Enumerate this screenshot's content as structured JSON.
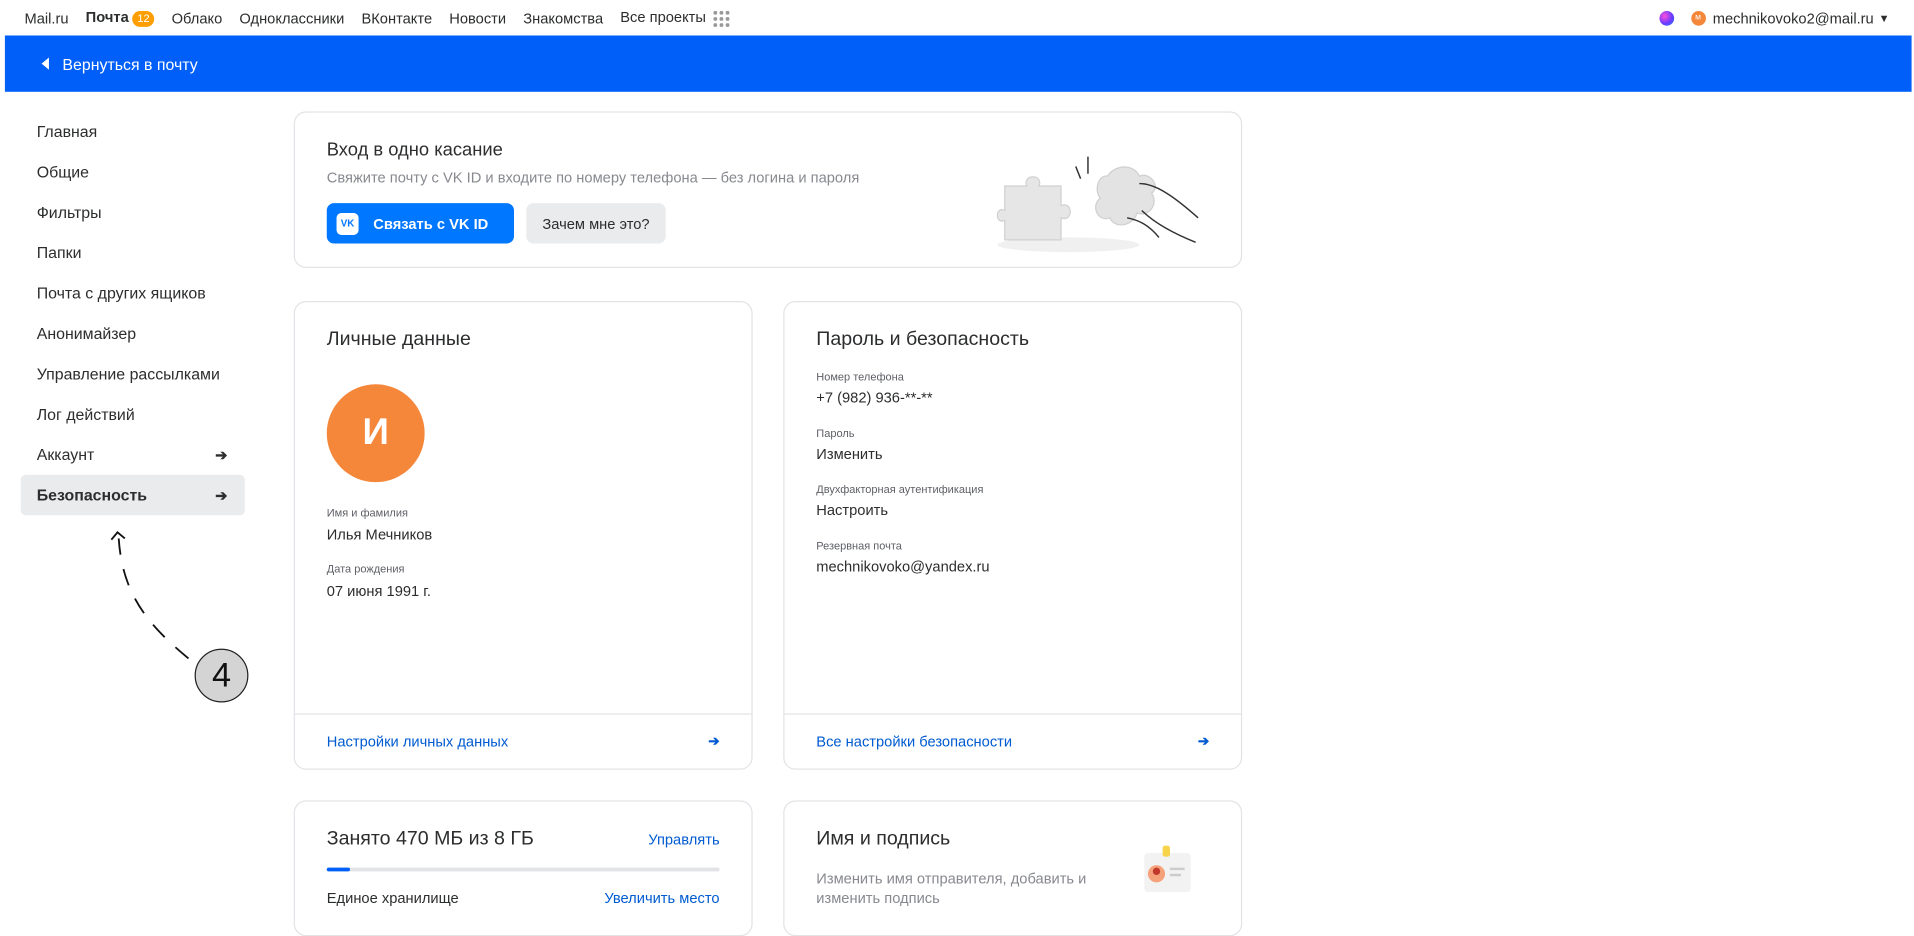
{
  "topnav": {
    "items": [
      "Mail.ru",
      "Почта",
      "Облако",
      "Одноклассники",
      "ВКонтакте",
      "Новости",
      "Знакомства",
      "Все проекты"
    ],
    "mail_badge": "12",
    "user_initial": "м",
    "user_email": "mechnikovoko2@mail.ru"
  },
  "bluebar": {
    "back_label": "Вернуться в почту"
  },
  "sidebar": {
    "items": [
      {
        "label": "Главная"
      },
      {
        "label": "Общие"
      },
      {
        "label": "Фильтры"
      },
      {
        "label": "Папки"
      },
      {
        "label": "Почта с других ящиков"
      },
      {
        "label": "Анонимайзер"
      },
      {
        "label": "Управление рассылками"
      },
      {
        "label": "Лог действий"
      },
      {
        "label": "Аккаунт"
      },
      {
        "label": "Безопасность"
      }
    ]
  },
  "onetouch": {
    "title": "Вход в одно касание",
    "subtitle": "Свяжите почту с VK ID и входите по номеру телефона — без логина и пароля",
    "vk_button": "Связать с VK ID",
    "vk_logo": "VK",
    "why_button": "Зачем мне это?"
  },
  "personal": {
    "title": "Личные данные",
    "avatar_letter": "И",
    "name_label": "Имя и фамилия",
    "name_value": "Илья Мечников",
    "birth_label": "Дата рождения",
    "birth_value": "07 июня 1991 г.",
    "footer_link": "Настройки личных данных"
  },
  "security": {
    "title": "Пароль и безопасность",
    "phone_label": "Номер телефона",
    "phone_value": "+7 (982) 936-**-**",
    "password_label": "Пароль",
    "password_link": "Изменить",
    "twofa_label": "Двухфакторная аутентификация",
    "twofa_link": "Настроить",
    "backup_label": "Резервная почта",
    "backup_value": "mechnikovoko@yandex.ru",
    "footer_link": "Все настройки безопасности"
  },
  "storage": {
    "title": "Занято 470 МБ из 8 ГБ",
    "manage_link": "Управлять",
    "used_fraction": 0.06,
    "unified_label": "Единое хранилище",
    "increase_link": "Увеличить место"
  },
  "signature": {
    "title": "Имя и подпись",
    "text": "Изменить имя отправителя, добавить и изменить подпись"
  },
  "annotation": {
    "step_number": "4"
  },
  "colors": {
    "accent": "#005ff9",
    "avatar": "#f5873b",
    "link": "#005bd1",
    "badge": "#ff9e00"
  }
}
